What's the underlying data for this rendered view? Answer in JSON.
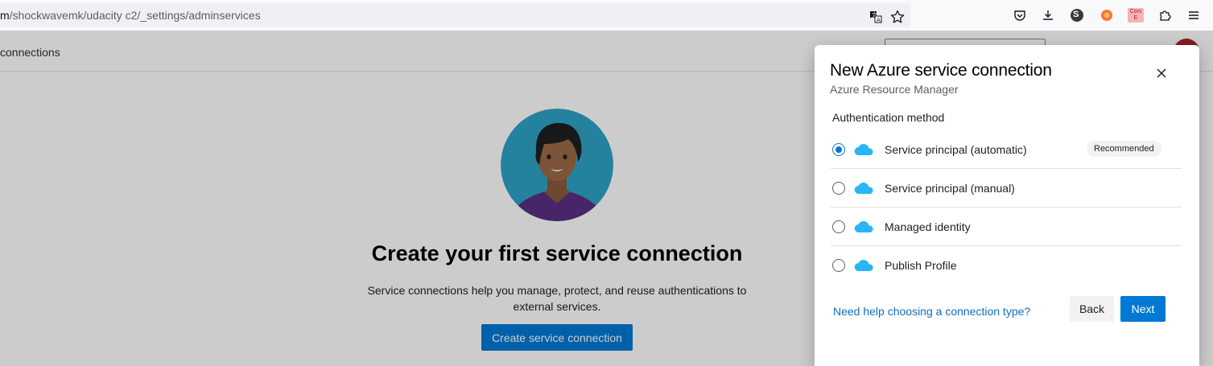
{
  "browser": {
    "url_host": "m",
    "url_path": "/shockwavemk/udacity c2/_settings/adminservices",
    "account_initial": "S",
    "extension_label": "Cors E"
  },
  "page": {
    "header_title": "connections",
    "empty_title": "Create your first service connection",
    "empty_description": "Service connections help you manage, protect, and reuse authentications to external services.",
    "create_button": "Create service connection"
  },
  "panel": {
    "title": "New Azure service connection",
    "subtitle": "Azure Resource Manager",
    "auth_label": "Authentication method",
    "options": [
      {
        "label": "Service principal (automatic)",
        "checked": true,
        "badge": "Recommended"
      },
      {
        "label": "Service principal (manual)",
        "checked": false
      },
      {
        "label": "Managed identity",
        "checked": false
      },
      {
        "label": "Publish Profile",
        "checked": false
      }
    ],
    "help_link": "Need help choosing a connection type?",
    "back_button": "Back",
    "next_button": "Next"
  },
  "colors": {
    "accent": "#0078d4",
    "avatar_bg": "#2ea3c6",
    "shirt": "#5b2d82",
    "cloud": "#29b6f6"
  },
  "icons": [
    "translate-icon",
    "bookmark-star-icon",
    "pocket-icon",
    "download-icon",
    "account-icon",
    "extension-icon",
    "cors-extension-icon",
    "puzzle-icon",
    "menu-icon",
    "close-icon",
    "azure-cloud-icon"
  ]
}
